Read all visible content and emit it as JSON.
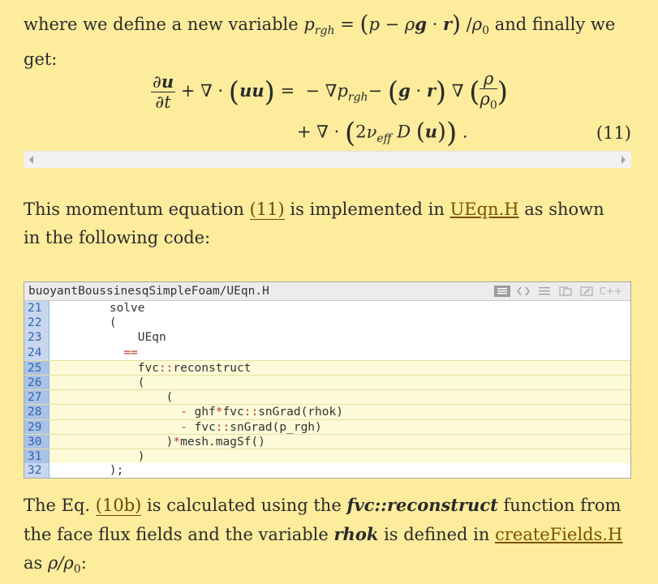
{
  "para1": {
    "lead": "where we define a new variable",
    "rest": "and finally we get:"
  },
  "equation": {
    "number": "(11)"
  },
  "para2": {
    "text1": "This momentum equation",
    "eqref": "(11)",
    "text2": "is implemented in",
    "link": "UEqn.H",
    "text3": "as shown in the following code:"
  },
  "code": {
    "title": "buoyantBoussinesqSimpleFoam/UEqn.H",
    "lang_label": "C++",
    "lines": [
      {
        "num": "21",
        "text": "        solve",
        "hl": false
      },
      {
        "num": "22",
        "text": "        (",
        "hl": false
      },
      {
        "num": "23",
        "text": "            UEqn",
        "hl": false
      },
      {
        "num": "24",
        "text": "          ==",
        "hl": false
      },
      {
        "num": "25",
        "text": "            fvc::reconstruct",
        "hl": true
      },
      {
        "num": "26",
        "text": "            (",
        "hl": true
      },
      {
        "num": "27",
        "text": "                (",
        "hl": true
      },
      {
        "num": "28",
        "text": "                  - ghf*fvc::snGrad(rhok)",
        "hl": true
      },
      {
        "num": "29",
        "text": "                  - fvc::snGrad(p_rgh)",
        "hl": true
      },
      {
        "num": "30",
        "text": "                )*mesh.magSf()",
        "hl": true
      },
      {
        "num": "31",
        "text": "            )",
        "hl": true
      },
      {
        "num": "32",
        "text": "        );",
        "hl": false
      }
    ]
  },
  "para3": {
    "text1": "The Eq.",
    "eqref": "(10b)",
    "text2": "is calculated using the",
    "func": "fvc::reconstruct",
    "text3": "function from the face flux fields and the variable",
    "var": "rhok",
    "text4": "is defined in",
    "link": "createFields.H",
    "text5": "as"
  }
}
